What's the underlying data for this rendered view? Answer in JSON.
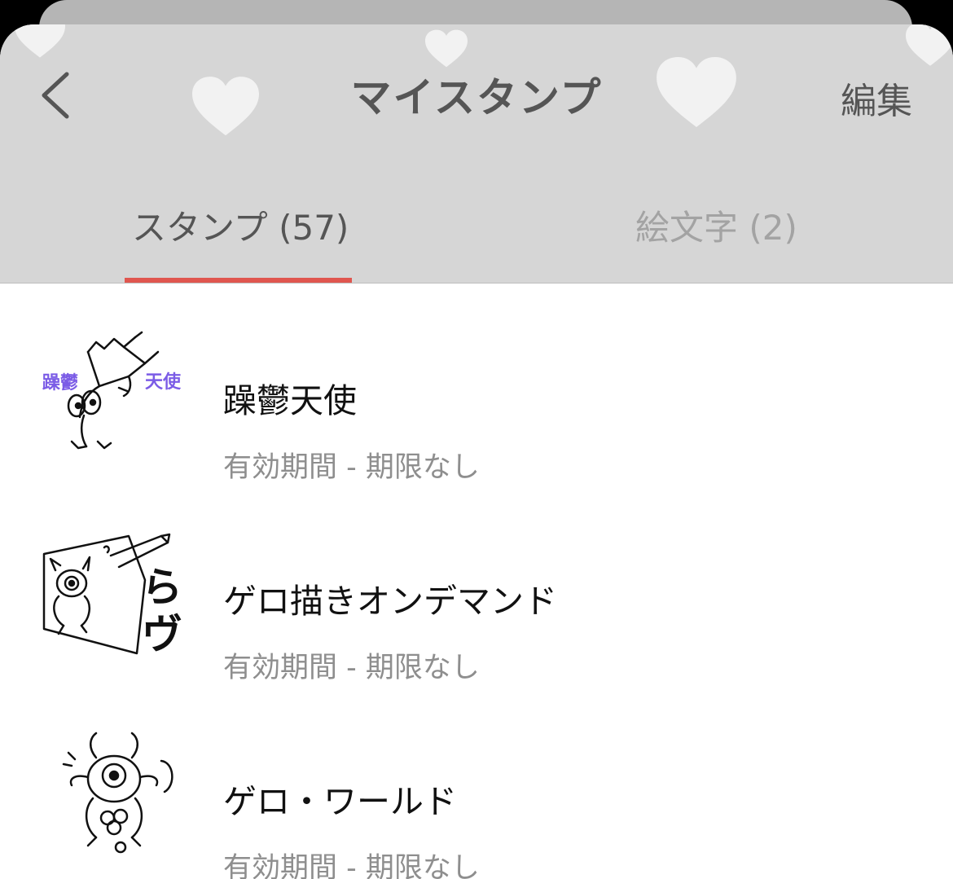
{
  "header": {
    "title": "マイスタンプ",
    "back_icon": "chevron-left-icon",
    "edit_label": "編集",
    "background_color": "#d6d6d6",
    "decoration_icon": "heart-icon"
  },
  "tabs": [
    {
      "label": "スタンプ (57)",
      "active": true
    },
    {
      "label": "絵文字 (2)",
      "active": false
    }
  ],
  "accent_color": "#e0564f",
  "stamps": [
    {
      "name": "躁鬱天使",
      "validity": "有効期間 - 期限なし",
      "thumb_text": [
        "躁鬱",
        "天使"
      ],
      "thumb_text_color": "#7b5ce6"
    },
    {
      "name": "ゲロ描きオンデマンド",
      "validity": "有効期間 - 期限なし",
      "thumb_text": [
        "ら",
        "ヴ"
      ]
    },
    {
      "name": "ゲロ・ワールド",
      "validity": "有効期間 - 期限なし",
      "thumb_text": []
    }
  ]
}
